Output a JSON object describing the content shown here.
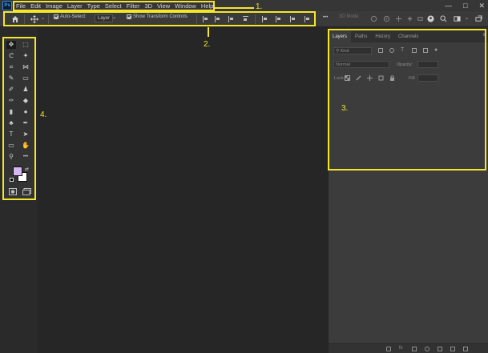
{
  "app": {
    "logo_text": "Ps"
  },
  "menu": [
    "File",
    "Edit",
    "Image",
    "Layer",
    "Type",
    "Select",
    "Filter",
    "3D",
    "View",
    "Window",
    "Help"
  ],
  "window_controls": {
    "minimize": "—",
    "maximize": "□",
    "close": "✕"
  },
  "options_bar": {
    "home_icon": "home-icon",
    "move_tool_icon": "move-tool-icon",
    "auto_select_label": "Auto-Select:",
    "auto_select_value": "Layer",
    "show_transform_label": "Show Transform Controls",
    "mode_3d_label": "3D Mode:",
    "more_label": "•••"
  },
  "tools": [
    {
      "name": "move-tool-icon",
      "glyph": "✥"
    },
    {
      "name": "marquee-tool-icon",
      "glyph": "⬚"
    },
    {
      "name": "lasso-tool-icon",
      "glyph": "ᕦ"
    },
    {
      "name": "magic-wand-tool-icon",
      "glyph": "✦"
    },
    {
      "name": "crop-tool-icon",
      "glyph": "⌗"
    },
    {
      "name": "slice-tool-icon",
      "glyph": "⋈"
    },
    {
      "name": "eyedropper-tool-icon",
      "glyph": "✎"
    },
    {
      "name": "frame-tool-icon",
      "glyph": "▭"
    },
    {
      "name": "brush-tool-icon",
      "glyph": "✐"
    },
    {
      "name": "stamp-tool-icon",
      "glyph": "♟"
    },
    {
      "name": "history-brush-tool-icon",
      "glyph": "✑"
    },
    {
      "name": "eraser-tool-icon",
      "glyph": "◆"
    },
    {
      "name": "gradient-tool-icon",
      "glyph": "▮"
    },
    {
      "name": "blur-tool-icon",
      "glyph": "●"
    },
    {
      "name": "dodge-tool-icon",
      "glyph": "♣"
    },
    {
      "name": "pen-tool-icon",
      "glyph": "✒"
    },
    {
      "name": "type-tool-icon",
      "glyph": "T"
    },
    {
      "name": "path-select-tool-icon",
      "glyph": "➤"
    },
    {
      "name": "rectangle-tool-icon",
      "glyph": "▭"
    },
    {
      "name": "hand-tool-icon",
      "glyph": "✋"
    },
    {
      "name": "zoom-tool-icon",
      "glyph": "⚲"
    },
    {
      "name": "edit-toolbar-icon",
      "glyph": "•••"
    }
  ],
  "colors": {
    "foreground": "#d4b6f0",
    "background": "#ffffff",
    "accent": "#f5e62a"
  },
  "layers_panel": {
    "tabs": [
      "Layers",
      "Paths",
      "History",
      "Channels"
    ],
    "active_tab": "Layers",
    "filter_kind": "Kind",
    "blend_mode": "Normal",
    "opacity_label": "Opacity:",
    "lock_label": "Lock:",
    "fill_label": "Fill:"
  },
  "annotations": {
    "menu": "1.",
    "options": "2.",
    "panels": "3.",
    "toolbar": "4."
  }
}
